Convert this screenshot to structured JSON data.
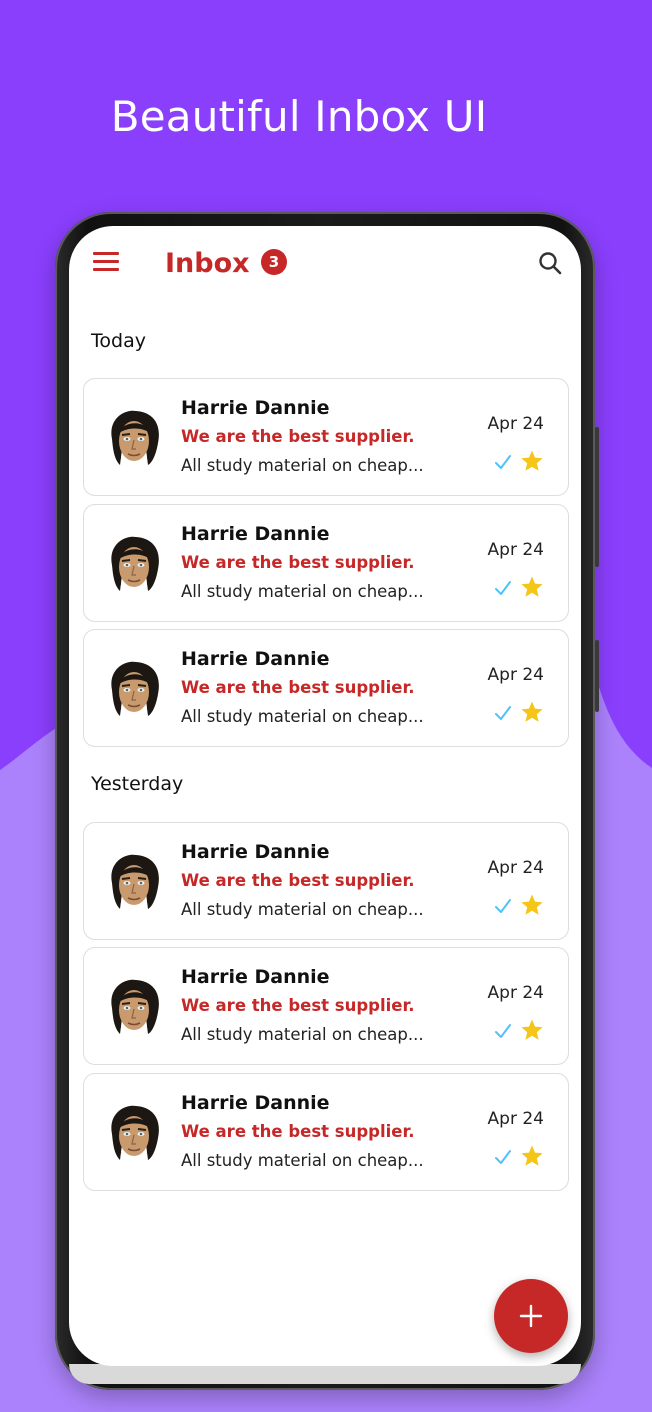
{
  "headline": "Beautiful Inbox UI",
  "colors": {
    "purple_top": "#8a3ffc",
    "purple_bottom": "#ab82fb",
    "accent_red": "#c62828",
    "check_blue": "#4fc3f7",
    "star_gold": "#f5c518"
  },
  "appbar": {
    "title": "Inbox",
    "badge_count": "3",
    "menu_icon": "hamburger-menu-icon",
    "search_icon": "search-icon"
  },
  "sections": [
    {
      "label": "Today",
      "emails": [
        {
          "sender": "Harrie Dannie",
          "subject": "We are the best supplier.",
          "preview": "All study material on cheap...",
          "date": "Apr 24",
          "read": true,
          "starred": true
        },
        {
          "sender": "Harrie Dannie",
          "subject": "We are the best supplier.",
          "preview": "All study material on cheap...",
          "date": "Apr 24",
          "read": true,
          "starred": true
        },
        {
          "sender": "Harrie Dannie",
          "subject": "We are the best supplier.",
          "preview": "All study material on cheap...",
          "date": "Apr 24",
          "read": true,
          "starred": true
        }
      ]
    },
    {
      "label": "Yesterday",
      "emails": [
        {
          "sender": "Harrie Dannie",
          "subject": "We are the best supplier.",
          "preview": "All study material on cheap...",
          "date": "Apr 24",
          "read": true,
          "starred": true
        },
        {
          "sender": "Harrie Dannie",
          "subject": "We are the best supplier.",
          "preview": "All study material on cheap...",
          "date": "Apr 24",
          "read": true,
          "starred": true
        },
        {
          "sender": "Harrie Dannie",
          "subject": "We are the best supplier.",
          "preview": "All study material on cheap...",
          "date": "Apr 24",
          "read": true,
          "starred": true
        }
      ]
    }
  ],
  "fab": {
    "icon": "plus-icon"
  }
}
